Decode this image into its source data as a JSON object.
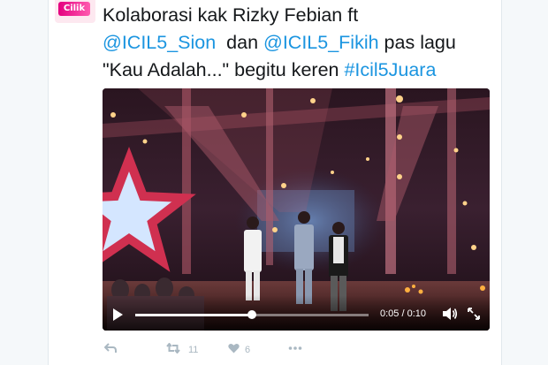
{
  "tweet": {
    "text_part1": "Kolaborasi  kak Rizky Febian ft",
    "mention1": "@ICIL5_Sion",
    "text_part2": "  dan ",
    "mention2": "@ICIL5_Fikih",
    "text_part3": " pas lagu",
    "text_part4": "\"Kau Adalah...\" begitu keren ",
    "hashtag": "#Icil5Juara"
  },
  "avatar": {
    "badge_text": "Cilik"
  },
  "video": {
    "elapsed": "0:05",
    "duration": "0:10",
    "time_separator": " / ",
    "progress": 0.5
  },
  "actions": {
    "reply_icon": "reply-icon",
    "retweet_icon": "retweet-icon",
    "retweet_count": "11",
    "like_icon": "heart-icon",
    "like_count": "6",
    "more_icon": "more-dots-icon"
  },
  "colors": {
    "link": "#1b95e0",
    "text": "#14171a",
    "action_gray": "#aab8c2"
  }
}
